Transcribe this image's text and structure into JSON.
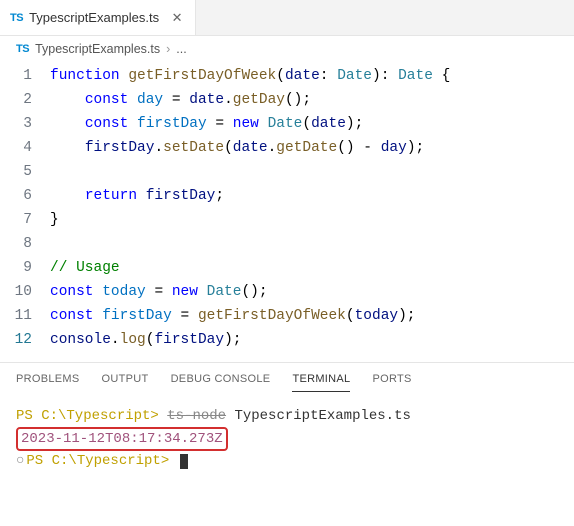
{
  "tab": {
    "icon_label": "TS",
    "filename": "TypescriptExamples.ts"
  },
  "breadcrumb": {
    "icon_label": "TS",
    "filename": "TypescriptExamples.ts",
    "ellipsis": "..."
  },
  "code": {
    "lines": [
      1,
      2,
      3,
      4,
      5,
      6,
      7,
      8,
      9,
      10,
      11,
      12
    ],
    "l1_kw_function": "function",
    "l1_fn": "getFirstDayOfWeek",
    "l1_param": "date",
    "l1_type": "Date",
    "l1_ret_type": "Date",
    "l2_kw_const": "const",
    "l2_var": "day",
    "l2_obj": "date",
    "l2_method": "getDay",
    "l3_kw_const": "const",
    "l3_var": "firstDay",
    "l3_kw_new": "new",
    "l3_type": "Date",
    "l3_arg": "date",
    "l4_obj": "firstDay",
    "l4_method": "setDate",
    "l4_arg_obj": "date",
    "l4_arg_method": "getDate",
    "l4_minus_var": "day",
    "l6_kw_return": "return",
    "l6_var": "firstDay",
    "l9_comment": "// Usage",
    "l10_kw_const": "const",
    "l10_var": "today",
    "l10_kw_new": "new",
    "l10_type": "Date",
    "l11_kw_const": "const",
    "l11_var": "firstDay",
    "l11_fn": "getFirstDayOfWeek",
    "l11_arg": "today",
    "l12_obj": "console",
    "l12_method": "log",
    "l12_arg": "firstDay"
  },
  "panel": {
    "tabs": {
      "problems": "PROBLEMS",
      "output": "OUTPUT",
      "debug_console": "DEBUG CONSOLE",
      "terminal": "TERMINAL",
      "ports": "PORTS"
    }
  },
  "terminal": {
    "prompt1_path": "PS C:\\Typescript>",
    "prompt1_cmd_struck": "ts-node",
    "prompt1_file": "TypescriptExamples.ts",
    "output_line": "2023-11-12T08:17:34.273Z",
    "prompt2_path": "PS C:\\Typescript>"
  }
}
